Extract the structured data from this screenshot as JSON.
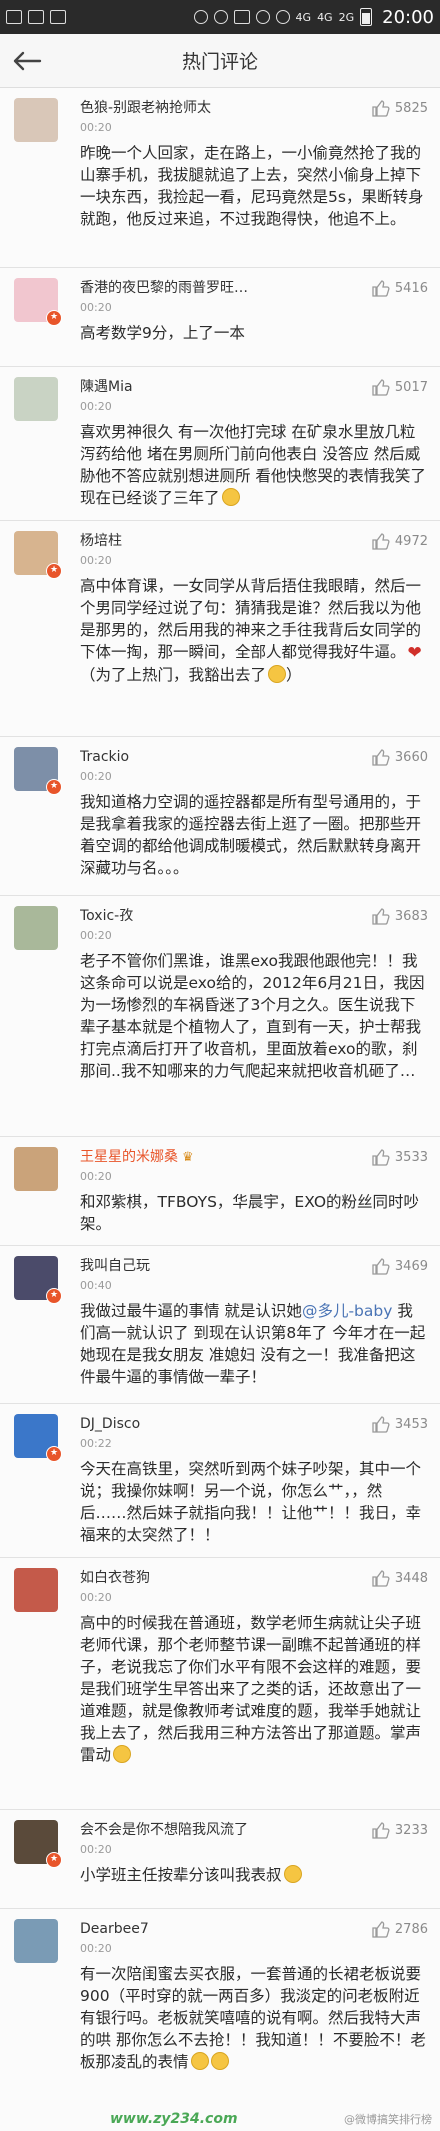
{
  "status_bar": {
    "network_1": "4G",
    "network_2": "4G",
    "network_3": "2G",
    "time": "20:00"
  },
  "header": {
    "title": "热门评论"
  },
  "comments": [
    {
      "username": "色狼-别跟老衲抢师太",
      "time": "00:20",
      "likes": "5825",
      "text": "昨晚一个人回家，走在路上，一小偷竟然抢了我的山寨手机，我拔腿就追了上去，突然小偷身上掉下一块东西，我捡起一看，尼玛竟然是5s，果断转身就跑，他反过来追，不过我跑得快，他追不上。",
      "avatar_color": "#d9c7b8"
    },
    {
      "username": "香港的夜巴黎的雨普罗旺…",
      "time": "00:20",
      "likes": "5416",
      "text": "高考数学9分，上了一本",
      "avatar_color": "#f1c6cf"
    },
    {
      "username": "陳遇Mia",
      "time": "00:20",
      "likes": "5017",
      "text": "喜欢男神很久 有一次他打完球 在矿泉水里放几粒泻药给他 堵在男厕所门前向他表白 没答应 然后威胁他不答应就别想进厕所 看他快憋哭的表情我笑了 现在已经谈了三年了",
      "avatar_color": "#c9d3c4"
    },
    {
      "username": "杨培柱",
      "time": "00:20",
      "likes": "4972",
      "text": "高中体育课，一女同学从背后捂住我眼睛，然后一个男同学经过说了句：猜猜我是谁？然后我以为他是那男的，然后用我的神来之手往我背后女同学的下体一掏，那一瞬间，全部人都觉得我好牛逼。",
      "text_2": "（为了上热门，我豁出去了",
      "avatar_color": "#d7b48f"
    },
    {
      "username": "Trackio",
      "time": "00:20",
      "likes": "3660",
      "text": "我知道格力空调的遥控器都是所有型号通用的，于是我拿着我家的遥控器去街上逛了一圈。把那些开着空调的都给他调成制暖模式，然后默默转身离开深藏功与名。。。",
      "avatar_color": "#7d8fa8"
    },
    {
      "username": "Toxic-孜",
      "time": "00:20",
      "likes": "3683",
      "text": "老子不管你们黑谁，谁黑exo我跟他跟他完！！我这条命可以说是exo给的，2012年6月21日，我因为一场惨烈的车祸昏迷了3个月之久。医生说我下辈子基本就是个植物人了，直到有一天，护士帮我打完点滴后打开了收音机，里面放着exo的歌，刹那间..我不知哪来的力气爬起来就把收音机砸了…",
      "avatar_color": "#a9b89a"
    },
    {
      "username": "王星星的米娜桑",
      "time": "00:20",
      "likes": "3533",
      "text": "和邓紫棋，TFBOYS，华晨宇，EXO的粉丝同时吵架。",
      "avatar_color": "#caa37a"
    },
    {
      "username": "我叫自己玩",
      "time": "00:40",
      "likes": "3469",
      "text_a": "我做过最牛逼的事情 就是认识她",
      "mention": "@多儿-baby",
      "text_b": " 我们高一就认识了 到现在认识第8年了 今年才在一起 她现在是我女朋友 准媳妇 没有之一！我准备把这件最牛逼的事情做一辈子！",
      "avatar_color": "#4b4b6a"
    },
    {
      "username": "DJ_Disco",
      "time": "00:22",
      "likes": "3453",
      "text": "今天在高铁里，突然听到两个妹子吵架，其中一个说；我操你妹啊！另一个说，你怎么艹，，然后……然后妹子就指向我！！让他艹！！我日，幸福来的太突然了！！",
      "avatar_color": "#3b77c9"
    },
    {
      "username": "如白衣苍狗",
      "time": "00:20",
      "likes": "3448",
      "text": "高中的时候我在普通班，数学老师生病就让尖子班老师代课，那个老师整节课一副瞧不起普通班的样子，老说我忘了你们水平有限不会这样的难题，要是我们班学生早答出来了之类的话，还故意出了一道难题，就是像教师考试难度的题，我举手她就让我上去了，然后我用三种方法答出了那道题。掌声雷动",
      "avatar_color": "#c45a4a"
    },
    {
      "username": "会不会是你不想陪我风流了",
      "time": "00:20",
      "likes": "3233",
      "text": "小学班主任按辈分该叫我表叔",
      "avatar_color": "#5a4a3a"
    },
    {
      "username": "Dearbee7",
      "time": "00:20",
      "likes": "2786",
      "text": "有一次陪闺蜜去买衣服，一套普通的长裙老板说要900（平时穿的就一两百多）我淡定的问老板附近有银行吗。老板就笑嘻嘻的说有啊。然后我特大声的哄 那你怎么不去抢！！我知道！！不要脸不！老板那凌乱的表情",
      "avatar_color": "#7a9bb5"
    }
  ],
  "watermark": {
    "site": "www.zy234.com",
    "source": "@微博搞笑排行榜"
  },
  "colors": {
    "vip_name": "#e8552a",
    "mention": "#4a74b5",
    "badge": "#e8552a"
  }
}
